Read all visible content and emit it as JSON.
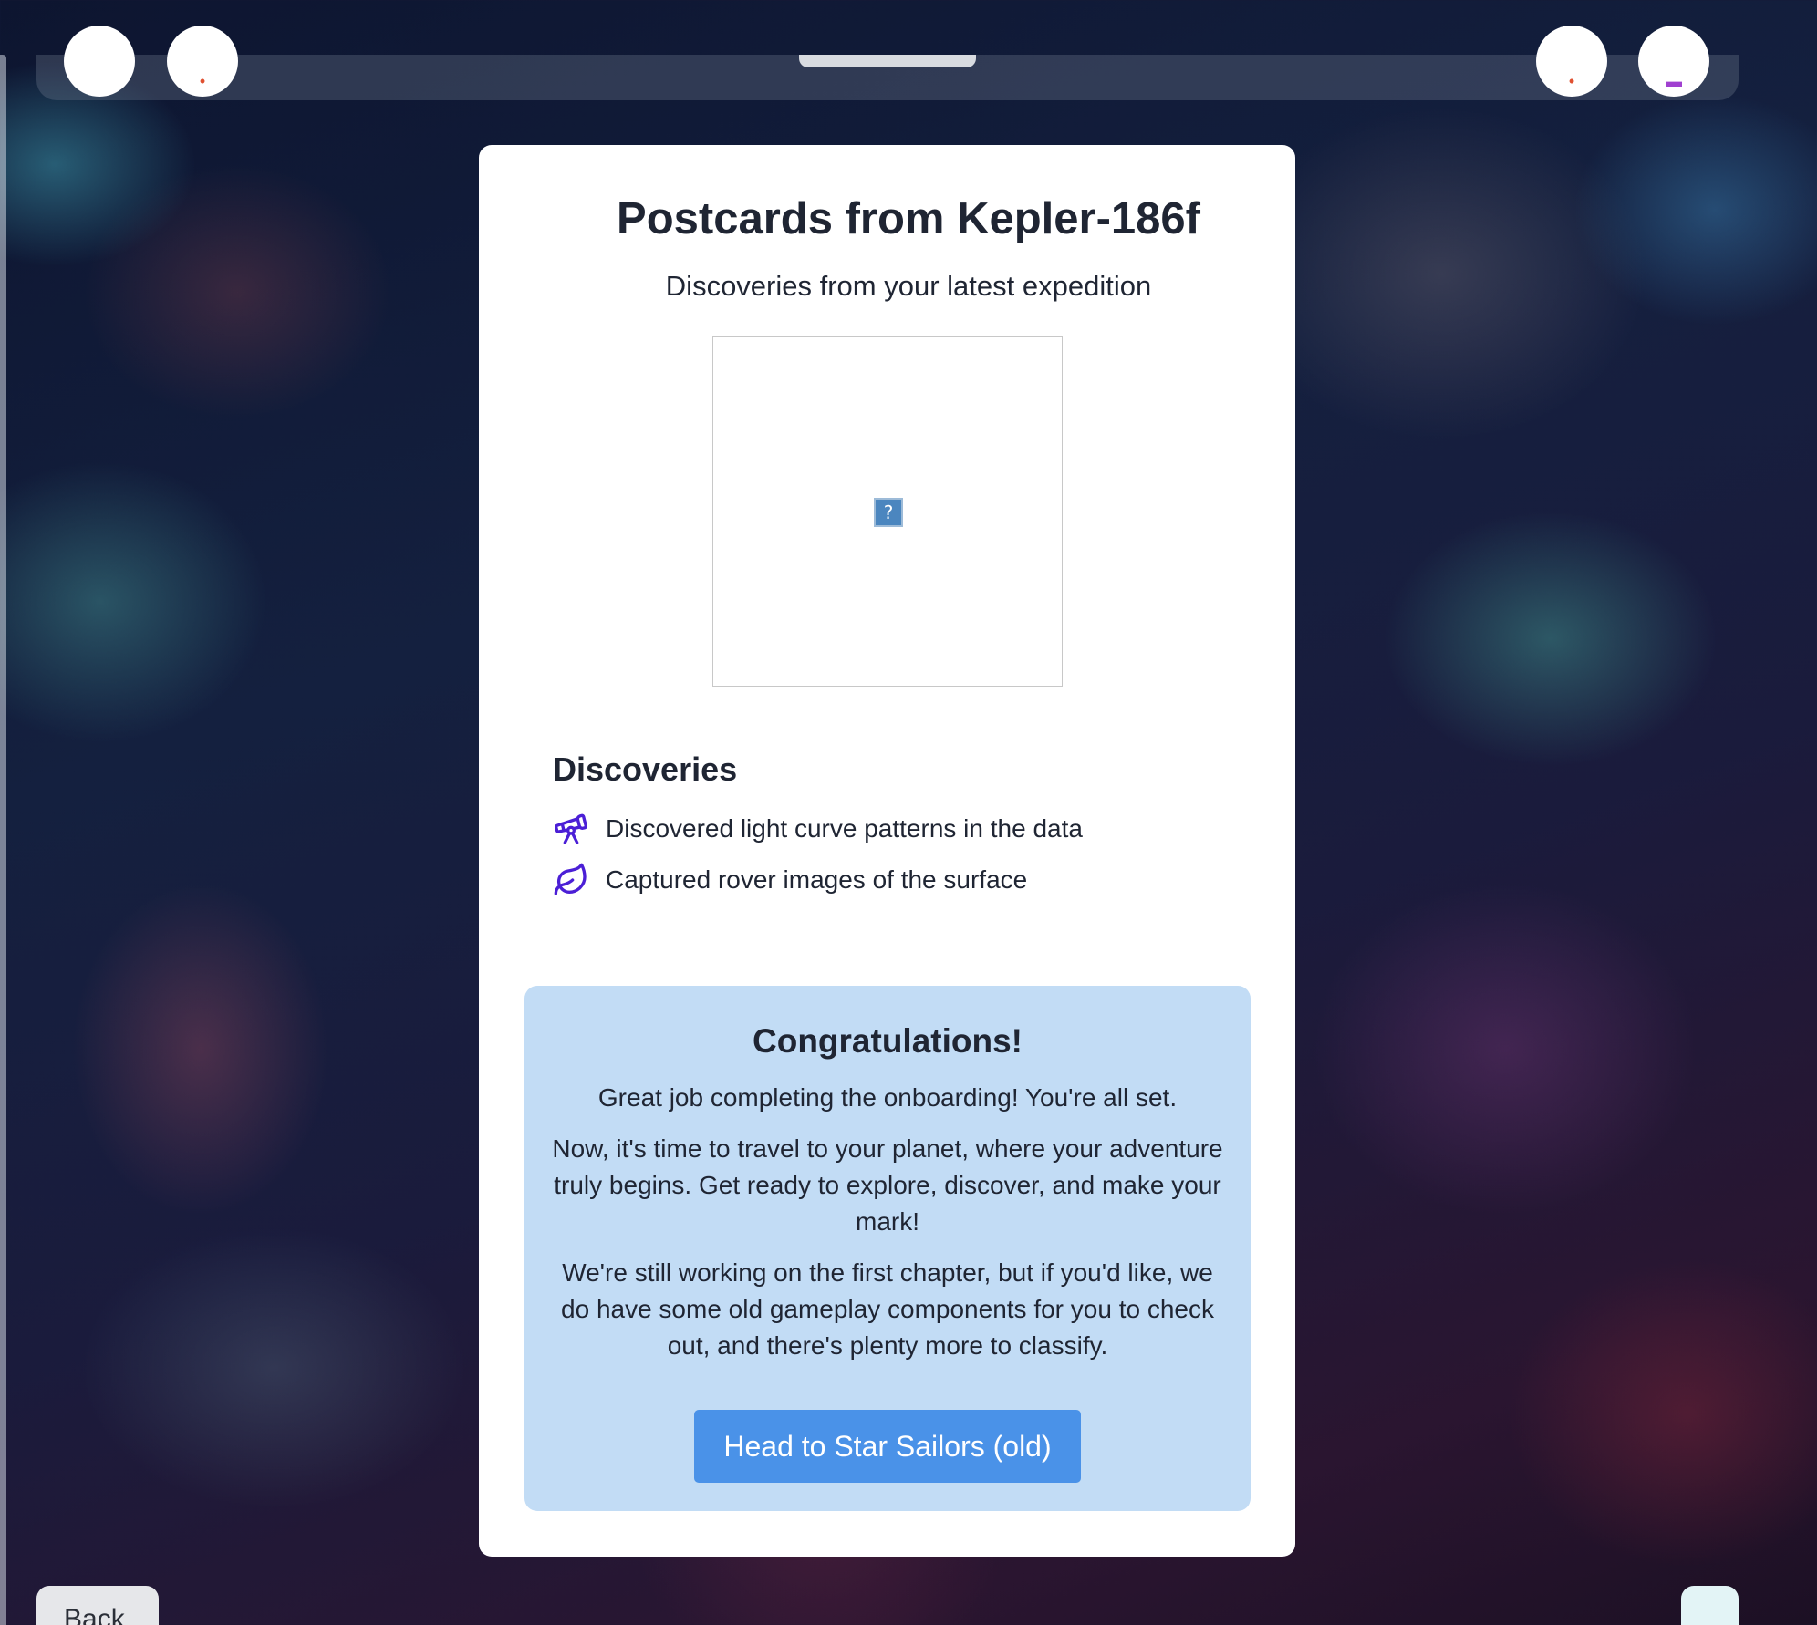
{
  "card": {
    "title": "Postcards from Kepler-186f",
    "subtitle": "Discoveries from your latest expedition",
    "image_alt_marker": "?"
  },
  "discoveries": {
    "heading": "Discoveries",
    "items": [
      {
        "icon": "telescope-icon",
        "text": "Discovered light curve patterns in the data"
      },
      {
        "icon": "leaf-icon",
        "text": "Captured rover images of the surface"
      }
    ]
  },
  "congrats": {
    "title": "Congratulations!",
    "p1": "Great job completing the onboarding! You're all set.",
    "p2": "Now, it's time to travel to your planet, where your adventure truly begins. Get ready to explore, discover, and make your mark!",
    "p3": "We're still working on the first chapter, but if you'd like, we do have some old gameplay components for you to check out, and there's plenty more to classify.",
    "button_label": "Head to Star Sailors (old)"
  },
  "footer": {
    "back_label": "Back"
  },
  "colors": {
    "accent_button": "#4a92e8",
    "congrats_bg": "#c2dcf5",
    "icon_purple": "#4b1fd6"
  }
}
